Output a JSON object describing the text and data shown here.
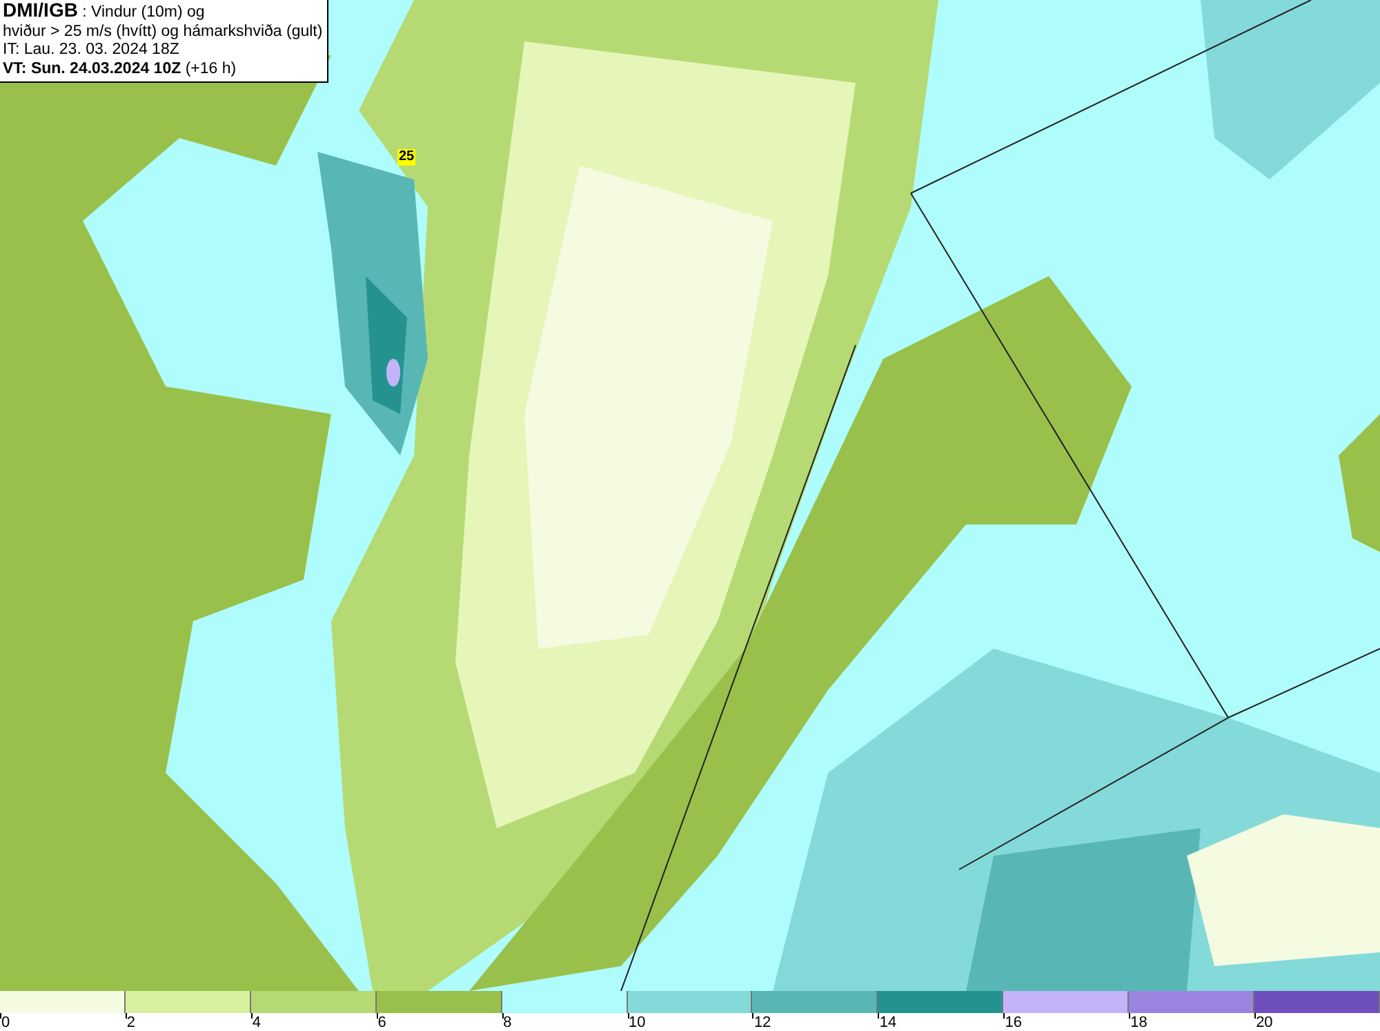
{
  "title_box": {
    "lines": [
      "**DMI/IGB** : Vindur (10m) og",
      "hviður > 25 m/s (hvítt) og hámarkshviða (gult)",
      "IT: Lau. 23. 03. 2024 18Z",
      "**VT: Sun. 24.03.2024 10Z** (+16 h)"
    ]
  },
  "map": {
    "gust_label": "25"
  },
  "legend": {
    "swatches": [
      {
        "color": "#f5fbe0"
      },
      {
        "color": "#d7f0a0"
      },
      {
        "color": "#b5da74"
      },
      {
        "color": "#99c04a"
      },
      {
        "color": "#aefcfc"
      },
      {
        "color": "#84d9d9"
      },
      {
        "color": "#58b7b5"
      },
      {
        "color": "#24938f"
      },
      {
        "color": "#c3b4fa"
      },
      {
        "color": "#9b84df"
      },
      {
        "color": "#6e4fbd"
      }
    ],
    "ticks": [
      "0",
      "2",
      "4",
      "6",
      "8",
      "10",
      "12",
      "14",
      "16",
      "18",
      "20"
    ]
  }
}
